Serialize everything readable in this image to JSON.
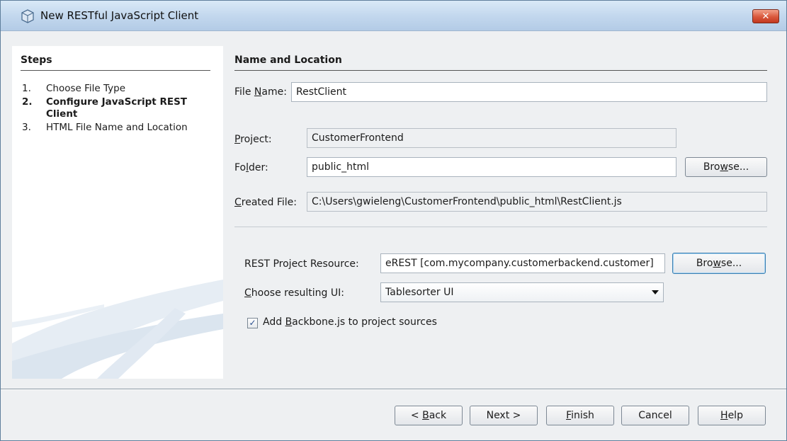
{
  "window": {
    "title": "New RESTful JavaScript Client",
    "close_label": "✕"
  },
  "steps": {
    "title": "Steps",
    "items": [
      {
        "num": "1.",
        "label": "Choose File Type",
        "active": false
      },
      {
        "num": "2.",
        "label": "Configure JavaScript REST Client",
        "active": true
      },
      {
        "num": "3.",
        "label": "HTML File Name and Location",
        "active": false
      }
    ]
  },
  "main": {
    "section_title": "Name and Location",
    "file_name": {
      "label_pre": "File ",
      "label_u": "N",
      "label_post": "ame:",
      "value": "RestClient"
    },
    "project": {
      "label_u": "P",
      "label_post": "roject:",
      "value": "CustomerFrontend"
    },
    "folder": {
      "label_pre": "Fo",
      "label_u": "l",
      "label_post": "der:",
      "value": "public_html",
      "browse_pre": "Bro",
      "browse_u": "w",
      "browse_post": "se..."
    },
    "created_file": {
      "label_u": "C",
      "label_post": "reated File:",
      "value": "C:\\Users\\gwieleng\\CustomerFrontend\\public_html\\RestClient.js"
    },
    "rest_resource": {
      "label_pre": "REST Pro",
      "label_u": "j",
      "label_post": "ect Resource:",
      "value": "eREST [com.mycompany.customerbackend.customer]",
      "browse_pre": "Bro",
      "browse_u": "w",
      "browse_post": "se..."
    },
    "ui": {
      "label_u": "C",
      "label_post": "hoose resulting UI:",
      "value": "Tablesorter UI"
    },
    "backbone": {
      "checked": true,
      "check_glyph": "✓",
      "label_pre": "Add ",
      "label_u": "B",
      "label_post": "ackbone.js to project sources"
    }
  },
  "footer": {
    "back": {
      "pre": "< ",
      "u": "B",
      "post": "ack"
    },
    "next": {
      "label": "Next >"
    },
    "finish": {
      "u": "F",
      "post": "inish"
    },
    "cancel": {
      "label": "Cancel"
    },
    "help": {
      "u": "H",
      "post": "elp"
    }
  },
  "colors": {
    "title_bar": "#c3d8ee",
    "dialog_bg": "#eef0f2",
    "close_button": "#d9573b"
  },
  "icons": [
    "window-cube-icon",
    "close-icon",
    "combo-chevron-down-icon",
    "checkbox-check-icon"
  ]
}
